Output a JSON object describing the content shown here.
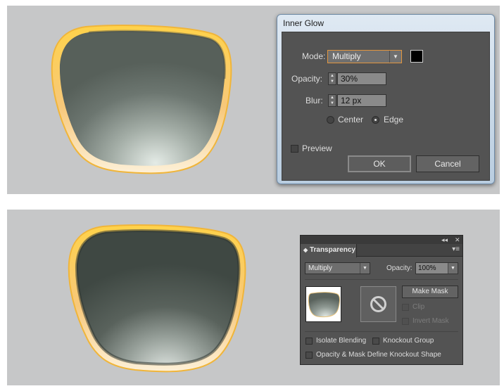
{
  "inner_glow": {
    "title": "Inner Glow",
    "mode_label": "Mode:",
    "mode_value": "Multiply",
    "color_swatch": "#000000",
    "opacity_label": "Opacity:",
    "opacity_value": "30%",
    "blur_label": "Blur:",
    "blur_value": "12 px",
    "center_label": "Center",
    "edge_label": "Edge",
    "selected_option": "Edge",
    "preview_label": "Preview",
    "preview_checked": false,
    "ok_label": "OK",
    "cancel_label": "Cancel"
  },
  "transparency": {
    "collapse_icon": "double-chevron-left",
    "close_icon": "close",
    "tab_label": "Transparency",
    "menu_icon": "panel-menu",
    "blend_mode": "Multiply",
    "opacity_label": "Opacity:",
    "opacity_value": "100%",
    "make_mask_label": "Make Mask",
    "clip_label": "Clip",
    "invert_mask_label": "Invert Mask",
    "isolate_blending_label": "Isolate Blending",
    "knockout_group_label": "Knockout Group",
    "opacity_mask_label": "Opacity & Mask Define Knockout Shape"
  },
  "colors": {
    "canvas_bg": "#c6c7c8",
    "panel_bg": "#535353",
    "lens_frame": "#f6c54a",
    "lens_glass": "#5a625d"
  }
}
